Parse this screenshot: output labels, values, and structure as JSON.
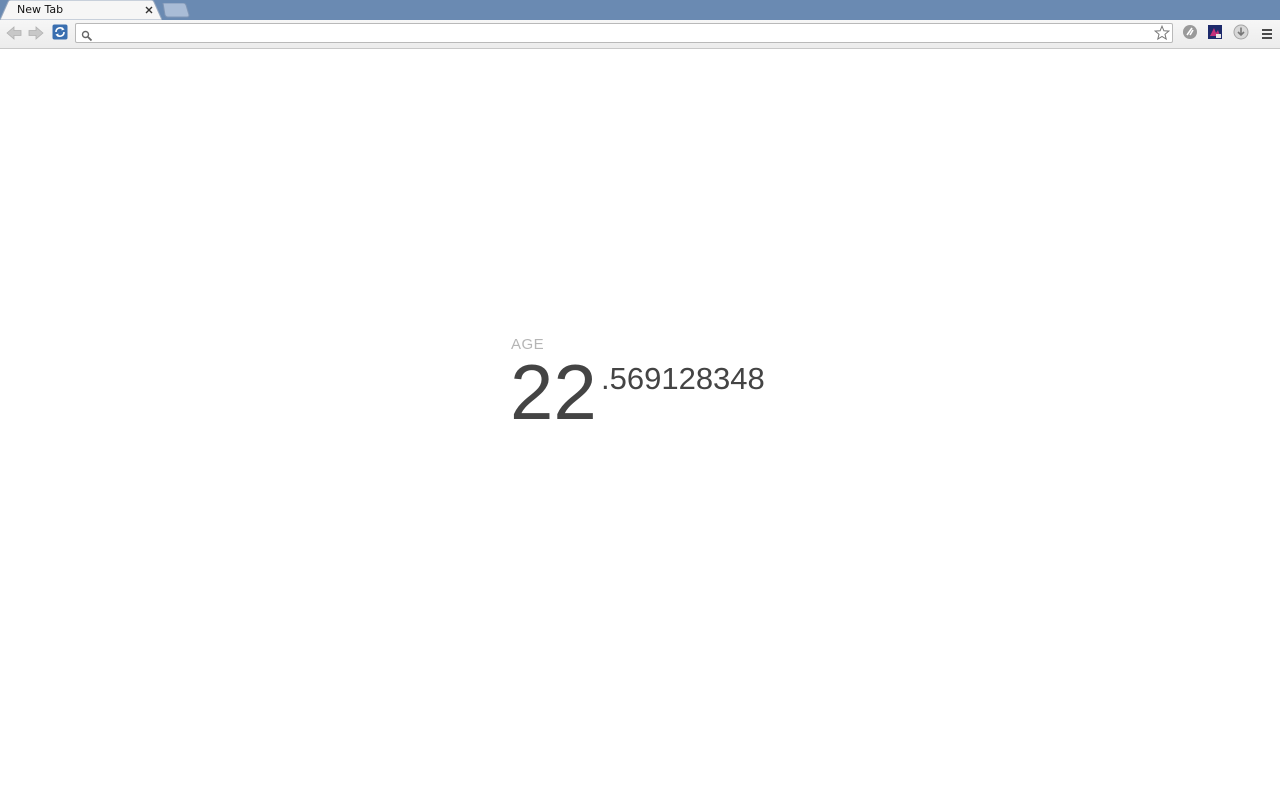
{
  "browser": {
    "tabs": [
      {
        "title": "New Tab"
      }
    ],
    "omnibox": {
      "value": "",
      "placeholder": ""
    }
  },
  "icons": {
    "back": "back-arrow-icon",
    "forward": "forward-arrow-icon",
    "reload": "reload-icon",
    "search": "search-icon",
    "bookmark": "star-icon",
    "extension_1": "extension-icon",
    "extension_2": "extension-icon",
    "extension_3": "download-icon",
    "menu": "hamburger-menu-icon"
  },
  "colors": {
    "tab_strip": "#6a8ab2",
    "age_label": "#b5b5b5",
    "age_value": "#444444"
  },
  "age": {
    "label": "AGE",
    "integer": "22",
    "fraction": ".569128348"
  }
}
